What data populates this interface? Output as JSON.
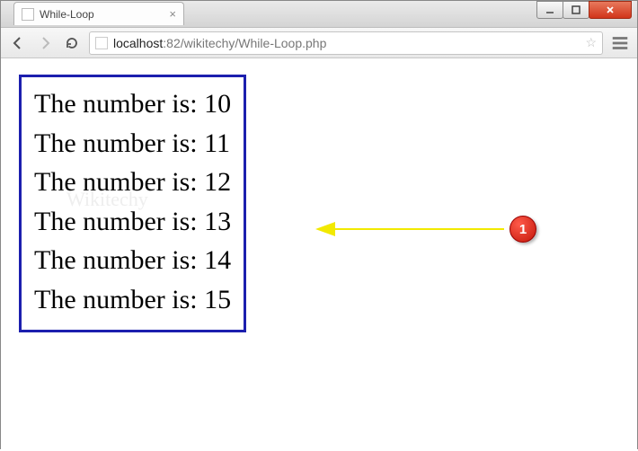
{
  "window": {
    "tab_title": "While-Loop",
    "url_host": "localhost",
    "url_port": ":82",
    "url_path": "/wikitechy/While-Loop.php"
  },
  "output": {
    "lines": [
      "The number is: 10",
      "The number is: 11",
      "The number is: 12",
      "The number is: 13",
      "The number is: 14",
      "The number is: 15"
    ]
  },
  "annotation": {
    "callout_number": "1"
  },
  "watermark": "Wikitechy"
}
